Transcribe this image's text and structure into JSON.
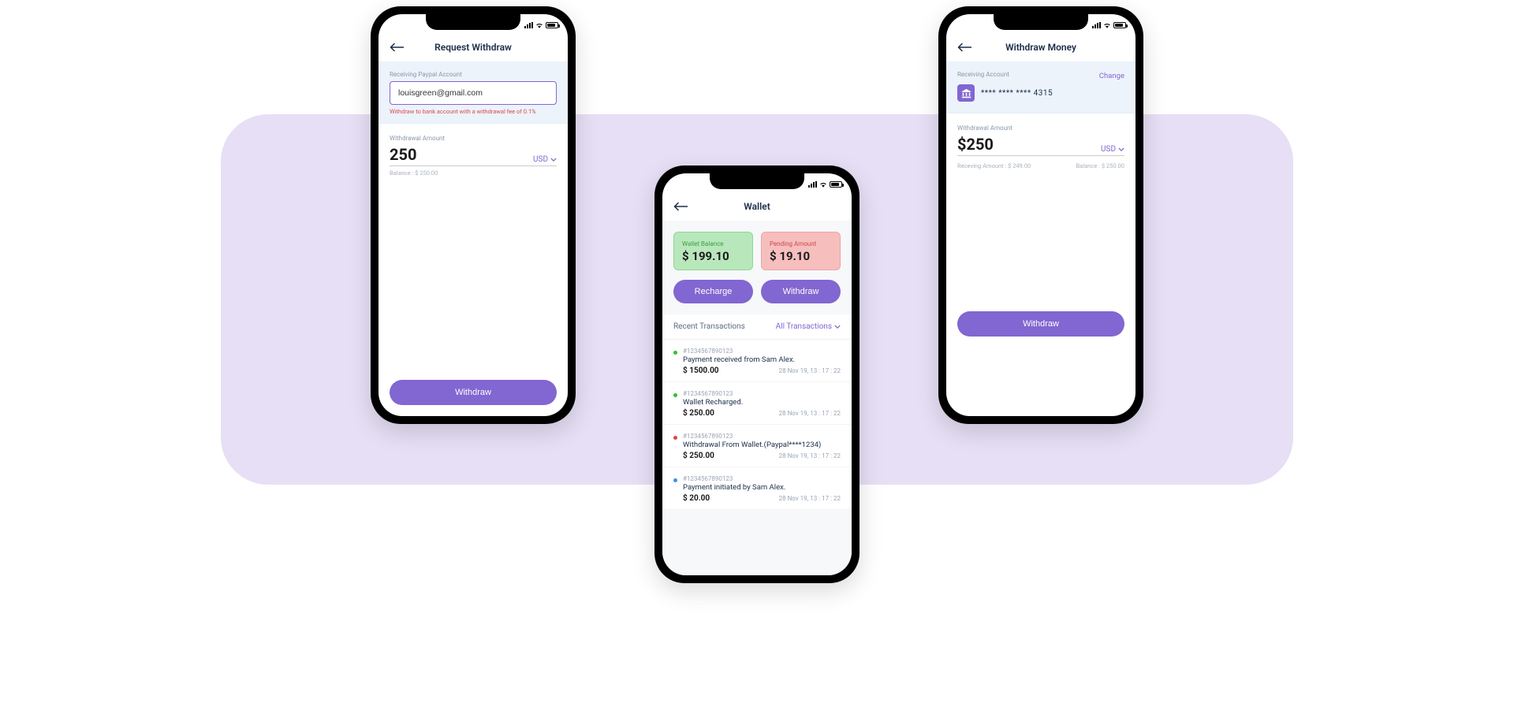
{
  "screen1": {
    "title": "Request Withdraw",
    "receiving_label": "Receiving Paypal Account",
    "email": "louisgreen@gmail.com",
    "fee_note": "Withdraw to bank account with a withdrawal fee of 0.1%",
    "amount_label": "Withdrawal Amount",
    "amount": "250",
    "currency": "USD",
    "balance_note": "Balance : $ 250.00",
    "withdraw_btn": "Withdraw"
  },
  "screen2": {
    "title": "Wallet",
    "balance_label": "Wallet Balance",
    "balance_value": "$ 199.10",
    "pending_label": "Pending Amount",
    "pending_value": "$ 19.10",
    "recharge_btn": "Recharge",
    "withdraw_btn": "Withdraw",
    "recent_title": "Recent Transactions",
    "filter_label": "All Transactions",
    "transactions": [
      {
        "id": "#1234567890123",
        "desc": "Payment received from Sam Alex.",
        "amount": "$ 1500.00",
        "date": "28 Nov 19, 13 : 17 : 22",
        "color": "green"
      },
      {
        "id": "#1234567890123",
        "desc": "Wallet Recharged.",
        "amount": "$ 250.00",
        "date": "28 Nov 19, 13 : 17 : 22",
        "color": "green"
      },
      {
        "id": "#1234567890123",
        "desc": "Withdrawal From Wallet.(Paypal****1234)",
        "amount": "$ 250.00",
        "date": "28 Nov 19, 13 : 17 : 22",
        "color": "red"
      },
      {
        "id": "#1234567890123",
        "desc": "Payment initiated by Sam Alex.",
        "amount": "$ 20.00",
        "date": "28 Nov 19, 13 : 17 : 22",
        "color": "blue"
      }
    ]
  },
  "screen3": {
    "title": "Withdraw Money",
    "receiving_label": "Receiving Account",
    "change_label": "Change",
    "account_number": "**** **** **** 4315",
    "amount_label": "Withdrawal Amount",
    "amount": "$250",
    "currency": "USD",
    "receiving_note": "Receving  Amount : $ 249.00",
    "balance_note": "Balance : $ 250.00",
    "withdraw_btn": "Withdraw"
  }
}
